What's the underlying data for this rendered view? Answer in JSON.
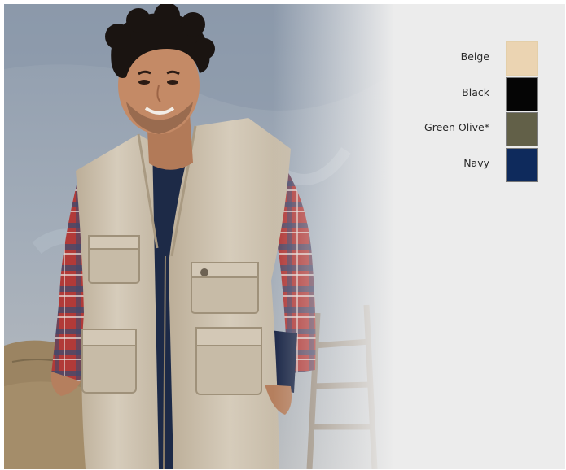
{
  "colors": {
    "panel_background": "#ececec",
    "wall": "#9aa7b5",
    "vest": "#cdc2b0",
    "shirt_plaid": "#b83d3a",
    "undershirt": "#1d2a47"
  },
  "photo": {
    "subject": "product-photo"
  },
  "swatches": [
    {
      "label": "Beige",
      "color": "#ebd4b2"
    },
    {
      "label": "Black",
      "color": "#050505"
    },
    {
      "label": "Green Olive*",
      "color": "#626048"
    },
    {
      "label": "Navy",
      "color": "#0e2a5c"
    }
  ]
}
